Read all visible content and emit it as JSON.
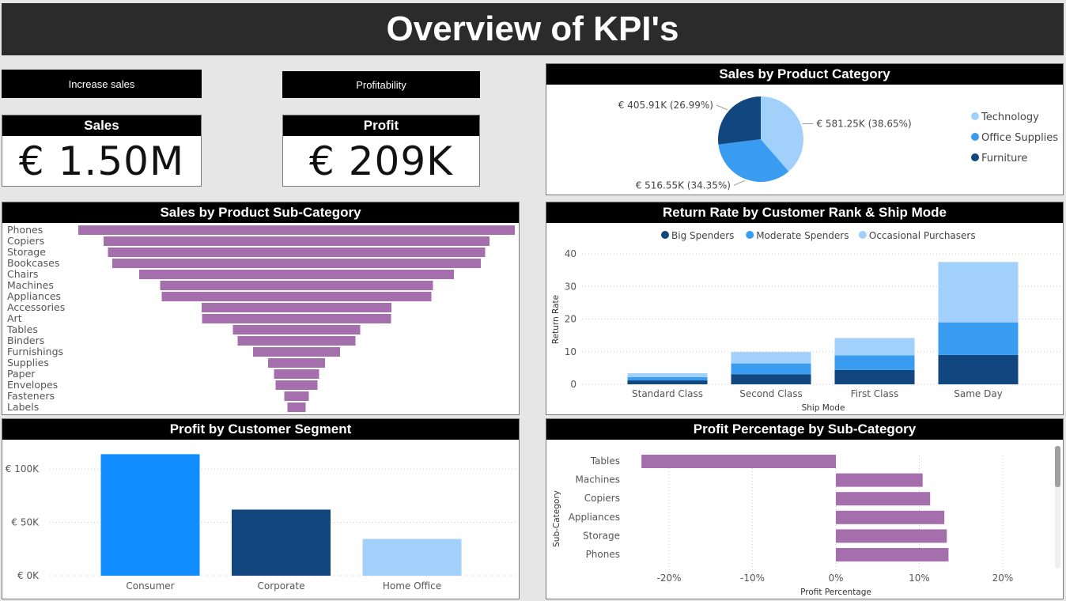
{
  "page": {
    "title": "Overview of KPI's"
  },
  "buttons": {
    "increase_sales": "Increase sales",
    "profitability": "Profitability"
  },
  "kpis": {
    "sales": {
      "label": "Sales",
      "value": "€ 1.50M"
    },
    "profit": {
      "label": "Profit",
      "value": "€ 209K"
    }
  },
  "colors": {
    "purple": "#a56fae",
    "bright_blue": "#118dff",
    "dark_blue": "#12467e",
    "medium_blue": "#3a9cf0",
    "light_blue": "#a1d0fb",
    "header": "#000000"
  },
  "chart_data": [
    {
      "id": "category_pie",
      "type": "pie",
      "title": "Sales by Product Category",
      "categories": [
        "Technology",
        "Office Supplies",
        "Furniture"
      ],
      "values": [
        581.25,
        516.55,
        405.91
      ],
      "data_labels": [
        "€ 581.25K (38.65%)",
        "€ 516.55K (34.35%)",
        "€ 405.91K (26.99%)"
      ],
      "colors": [
        "#a1d0fb",
        "#3a9cf0",
        "#12467e"
      ],
      "legend_position": "right"
    },
    {
      "id": "subcategory_funnel",
      "type": "bar",
      "orientation": "funnel",
      "title": "Sales by Product Sub-Category",
      "categories": [
        "Phones",
        "Copiers",
        "Storage",
        "Bookcases",
        "Chairs",
        "Machines",
        "Appliances",
        "Accessories",
        "Art",
        "Tables",
        "Binders",
        "Furnishings",
        "Supplies",
        "Paper",
        "Envelopes",
        "Fasteners",
        "Labels"
      ],
      "values": [
        552,
        488,
        477,
        466,
        398,
        345,
        341,
        240,
        239,
        161,
        149,
        110,
        72,
        57,
        53,
        31,
        23
      ]
    },
    {
      "id": "return_rate",
      "type": "bar",
      "stacked": true,
      "title": "Return Rate by Customer Rank & Ship Mode",
      "categories": [
        "Standard Class",
        "Second Class",
        "First Class",
        "Same Day"
      ],
      "xlabel": "Ship Mode",
      "ylabel": "Return Rate",
      "ylim": [
        0,
        40
      ],
      "yticks": [
        0,
        10,
        20,
        30,
        40
      ],
      "grid": true,
      "legend_position": "top",
      "series": [
        {
          "name": "Big Spenders",
          "values": [
            1.2,
            3.1,
            4.4,
            9.0
          ],
          "color": "#12467e"
        },
        {
          "name": "Moderate Spenders",
          "values": [
            1.0,
            3.3,
            4.5,
            10.0
          ],
          "color": "#3a9cf0"
        },
        {
          "name": "Occasional Purchasers",
          "values": [
            1.2,
            3.5,
            5.3,
            18.5
          ],
          "color": "#a1d0fb"
        }
      ]
    },
    {
      "id": "profit_segment",
      "type": "bar",
      "title": "Profit by Customer Segment",
      "categories": [
        "Consumer",
        "Corporate",
        "Home Office"
      ],
      "values": [
        114000,
        62000,
        34500
      ],
      "colors": [
        "#118dff",
        "#12467e",
        "#a1d0fb"
      ],
      "ylim": [
        0,
        115000
      ],
      "yticks": [
        0,
        50000,
        100000
      ],
      "ytick_labels": [
        "€ 0K",
        "€ 50K",
        "€ 100K"
      ],
      "grid": true
    },
    {
      "id": "profit_pct",
      "type": "bar",
      "orientation": "horizontal",
      "title": "Profit Percentage by Sub-Category",
      "categories": [
        "Tables",
        "Machines",
        "Copiers",
        "Appliances",
        "Storage",
        "Phones"
      ],
      "values": [
        -23.3,
        10.4,
        11.3,
        13.0,
        13.3,
        13.5
      ],
      "xlabel": "Profit Percentage",
      "ylabel": "Sub-Category",
      "xlim": [
        -25,
        25
      ],
      "xticks": [
        -20,
        -10,
        0,
        10,
        20
      ],
      "xtick_labels": [
        "-20%",
        "-10%",
        "0%",
        "10%",
        "20%"
      ],
      "grid": true
    }
  ]
}
